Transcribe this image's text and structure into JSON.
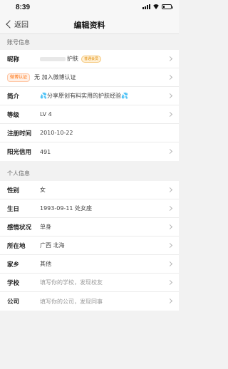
{
  "status_bar": {
    "time": "8:39"
  },
  "nav": {
    "back_label": "返回",
    "title": "编辑资料"
  },
  "account_section": {
    "header": "账号信息",
    "nickname": {
      "label": "昵称",
      "value_suffix": "护肤",
      "badge": "普通会员"
    },
    "weibo": {
      "badge": "微博认证",
      "value": "无 加入微博认证"
    },
    "bio": {
      "label": "简介",
      "value": "分享原创有料实用的护肤经验",
      "emoji": "💦"
    },
    "level": {
      "label": "等级",
      "value": "LV 4"
    },
    "register": {
      "label": "注册时间",
      "value": "2010-10-22"
    },
    "credit": {
      "label": "阳光信用",
      "value": "491"
    }
  },
  "personal_section": {
    "header": "个人信息",
    "rows": [
      {
        "key": "gender",
        "label": "性别",
        "value": "女",
        "placeholder": false
      },
      {
        "key": "birthday",
        "label": "生日",
        "value": "1993-09-11 处女座",
        "placeholder": false
      },
      {
        "key": "relationship",
        "label": "感情状况",
        "value": "单身",
        "placeholder": false
      },
      {
        "key": "location",
        "label": "所在地",
        "value": "广西 北海",
        "placeholder": false
      },
      {
        "key": "hometown",
        "label": "家乡",
        "value": "其他",
        "placeholder": false
      },
      {
        "key": "school",
        "label": "学校",
        "value": "填写你的学校，发现校友",
        "placeholder": true
      },
      {
        "key": "company",
        "label": "公司",
        "value": "填写你的公司，发现同事",
        "placeholder": true
      }
    ]
  }
}
